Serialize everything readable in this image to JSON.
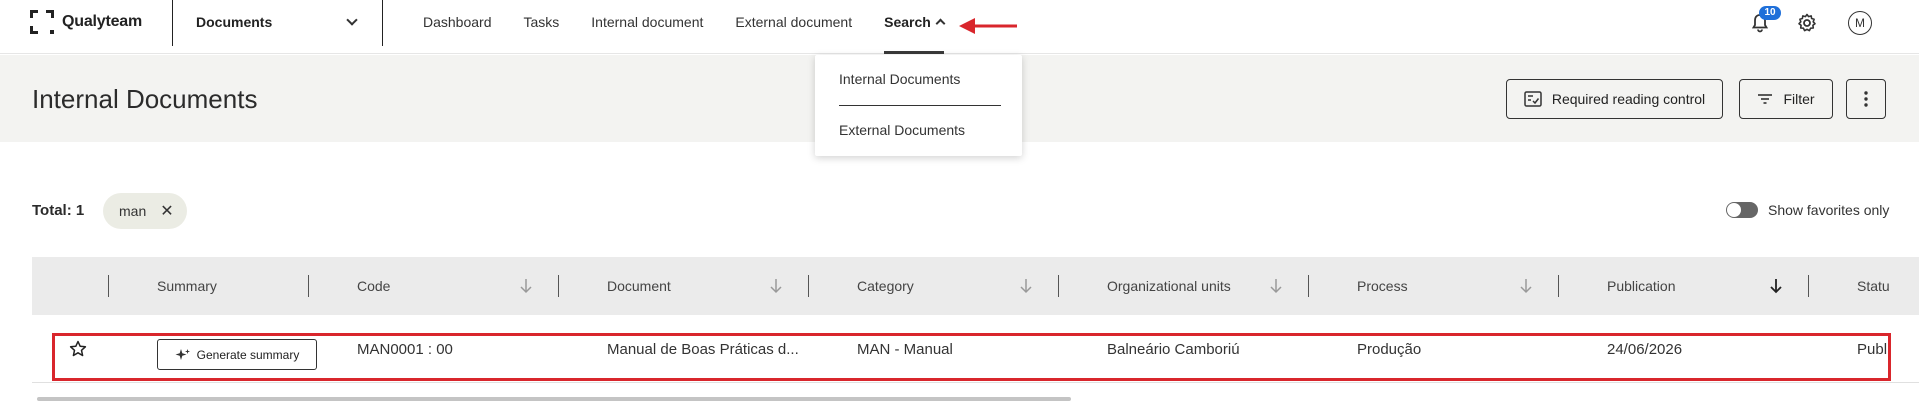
{
  "app": {
    "name": "Qualyteam"
  },
  "module_select": {
    "label": "Documents"
  },
  "nav": {
    "items": [
      "Dashboard",
      "Tasks",
      "Internal document",
      "External document"
    ],
    "active": "Search"
  },
  "notifications": {
    "count": "10"
  },
  "user": {
    "initial": "M"
  },
  "page": {
    "title": "Internal Documents"
  },
  "actions": {
    "required_reading": "Required reading control",
    "filter": "Filter"
  },
  "search_menu": {
    "items": [
      "Internal Documents",
      "External Documents"
    ]
  },
  "filters": {
    "total": "Total: 1",
    "chip": "man",
    "show_favorites": "Show favorites only",
    "show_favorites_on": false
  },
  "table": {
    "columns": [
      "Summary",
      "Code",
      "Document",
      "Category",
      "Organizational units",
      "Process",
      "Publication",
      "Statu"
    ],
    "rows": [
      {
        "generate_summary": "Generate summary",
        "code": "MAN0001 : 00",
        "document": "Manual de Boas Práticas d...",
        "category": "MAN - Manual",
        "org_unit": "Balneário Camboriú",
        "process": "Produção",
        "publication": "24/06/2026",
        "status": "Publ"
      }
    ]
  },
  "colors": {
    "accent_badge": "#1e6fd9",
    "annotation_red": "#d9262c",
    "header_band": "#f3f3f1",
    "table_header": "#ebebeb"
  }
}
